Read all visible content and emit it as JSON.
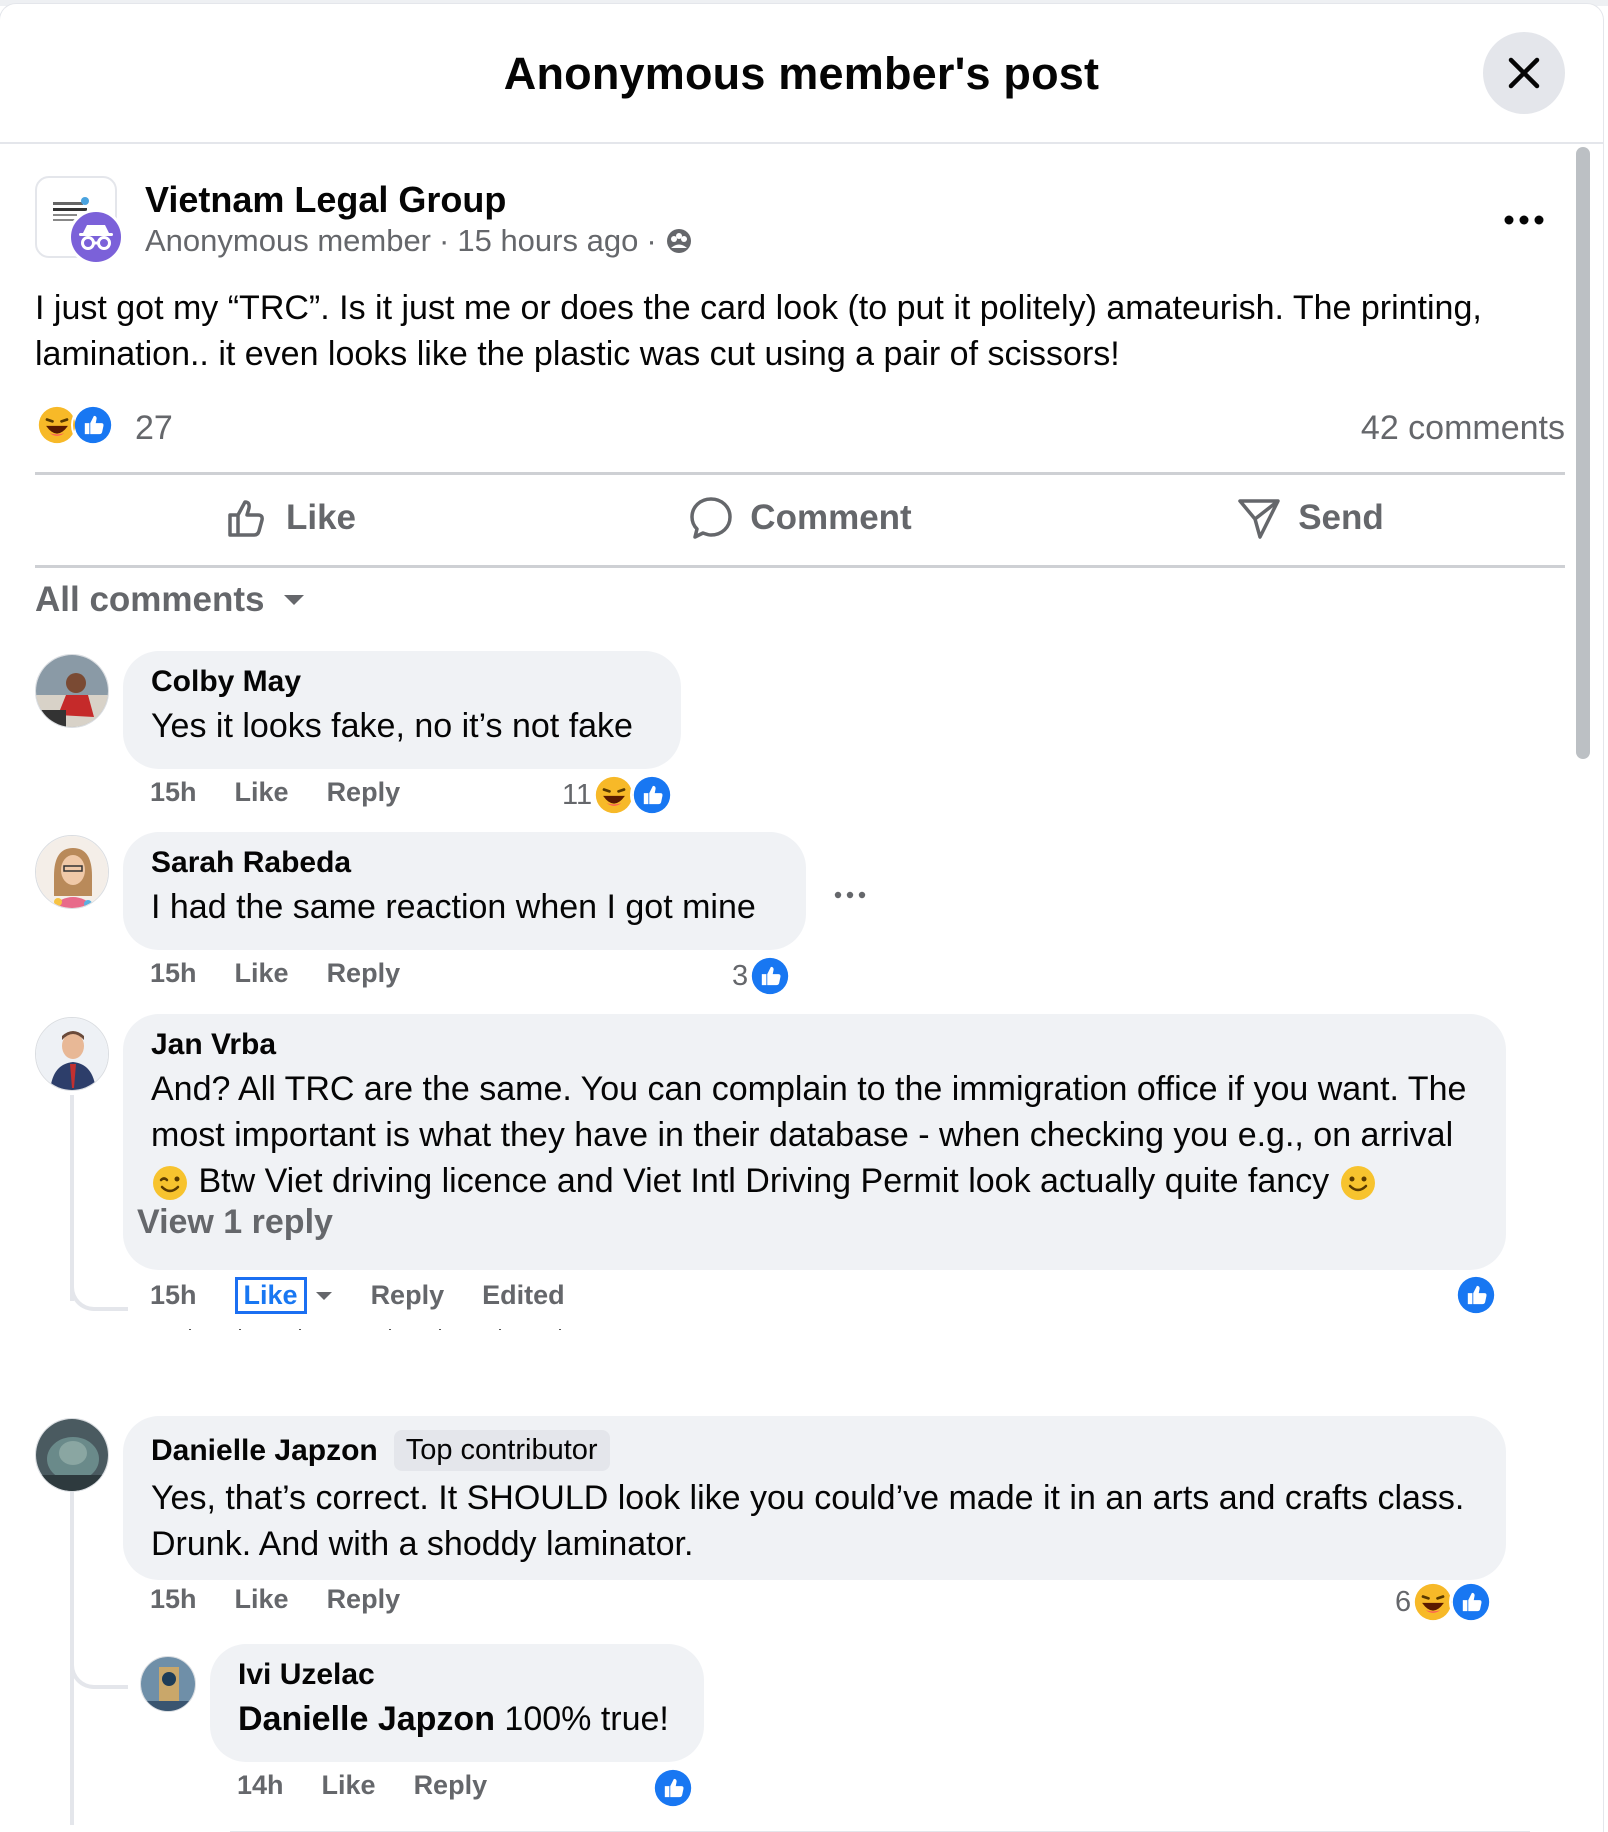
{
  "header": {
    "title": "Anonymous member's post"
  },
  "post": {
    "group_name": "Vietnam Legal Group",
    "author": "Anonymous member",
    "time": "15 hours ago",
    "text": "I just got my “TRC”. Is it just me or does the card look (to put it politely) amateurish. The printing, lamination.. it even looks like the plastic was cut using a pair of scissors!",
    "reaction_count": "27",
    "comments_count": "42 comments"
  },
  "actions": {
    "like": "Like",
    "comment": "Comment",
    "send": "Send"
  },
  "sort": {
    "label": "All comments"
  },
  "comments": [
    {
      "name": "Colby May",
      "text": "Yes it looks fake, no it’s not fake",
      "time": "15h",
      "like": "Like",
      "reply": "Reply",
      "reactions": "11"
    },
    {
      "name": "Sarah Rabeda",
      "text": "I had the same reaction when I got mine",
      "time": "15h",
      "like": "Like",
      "reply": "Reply",
      "reactions": "3"
    },
    {
      "name": "Jan Vrba",
      "text_1": "And? All TRC are the same. You can complain to the immigration office if you want. The most important is what they have in their database - when checking you e.g., on arrival",
      "text_2": "Btw Viet driving licence and Viet Intl Driving Permit look actually quite fancy",
      "time": "15h",
      "like": "Like",
      "reply": "Reply",
      "edited": "Edited",
      "view_reply": "View 1 reply"
    },
    {
      "name": "Danielle Japzon",
      "badge": "Top contributor",
      "text": "Yes, that’s correct. It SHOULD look like you could’ve made it in an arts and crafts class. Drunk. And with a shoddy laminator.",
      "time": "15h",
      "like": "Like",
      "reply": "Reply",
      "reactions": "6"
    },
    {
      "name": "Ivi Uzelac",
      "mention": "Danielle Japzon",
      "text": " 100% true!",
      "time": "14h",
      "like": "Like",
      "reply": "Reply"
    }
  ],
  "colors": {
    "like_blue": "#1877f2",
    "haha_yellow": "#f7b928",
    "secondary_text": "#65676b",
    "bubble_bg": "#f0f2f5"
  },
  "icons": [
    "close-icon",
    "more-icon",
    "like-icon",
    "comment-icon",
    "send-icon",
    "caret-down-icon",
    "haha-reaction-icon",
    "like-reaction-icon",
    "wink-emoji",
    "smile-emoji",
    "globe-icon"
  ]
}
